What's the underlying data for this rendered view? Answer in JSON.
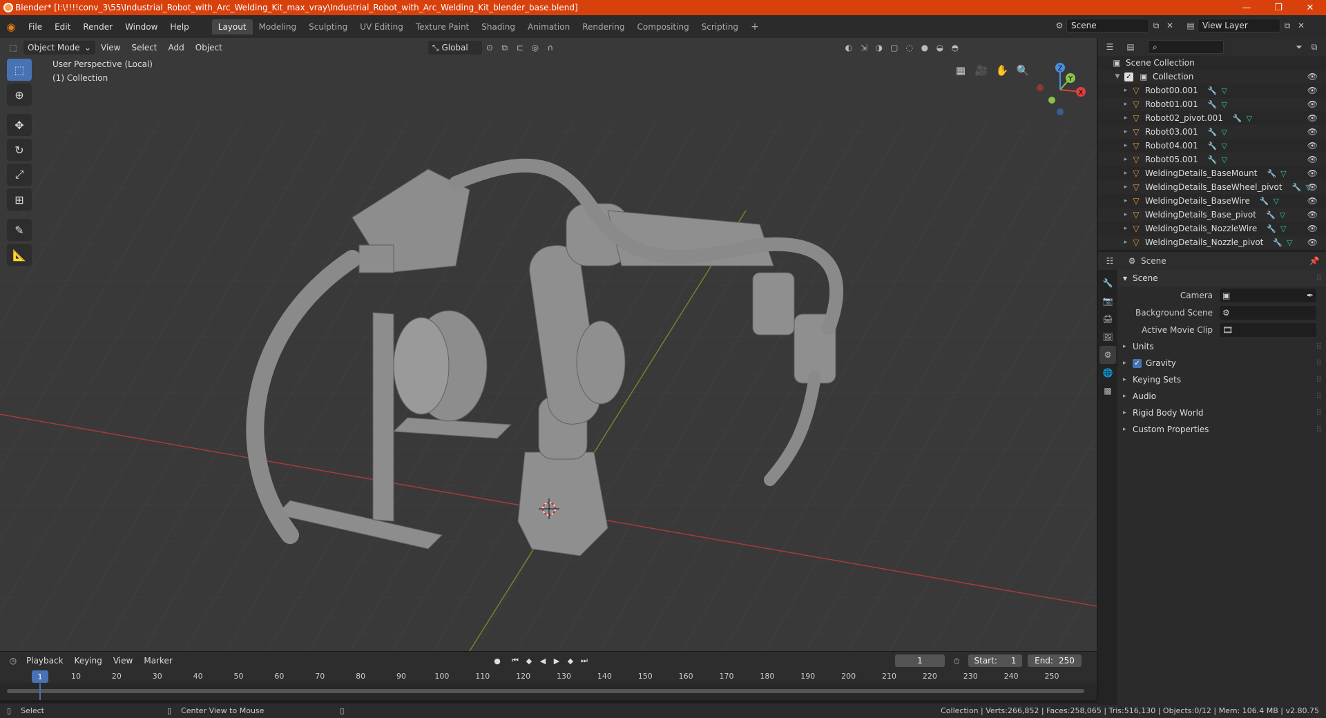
{
  "window": {
    "title": "Blender* [I:\\!!!!conv_3\\55\\Industrial_Robot_with_Arc_Welding_Kit_max_vray\\Industrial_Robot_with_Arc_Welding_Kit_blender_base.blend]",
    "minimize": "—",
    "maximize": "❐",
    "close": "✕"
  },
  "menu": [
    "File",
    "Edit",
    "Render",
    "Window",
    "Help"
  ],
  "workspaces": [
    "Layout",
    "Modeling",
    "Sculpting",
    "UV Editing",
    "Texture Paint",
    "Shading",
    "Animation",
    "Rendering",
    "Compositing",
    "Scripting"
  ],
  "active_workspace": "Layout",
  "workspace_add": "+",
  "scene_name": "Scene",
  "view_layer": "View Layer",
  "viewport": {
    "mode": "Object Mode",
    "menu": [
      "View",
      "Select",
      "Add",
      "Object"
    ],
    "transform_orientation": "Global",
    "perspective_label": "User Perspective (Local)",
    "collection_label": "(1) Collection",
    "gizmo": {
      "x": "X",
      "y": "Y",
      "z": "Z"
    }
  },
  "timeline": {
    "menu": [
      "Playback",
      "Keying",
      "View",
      "Marker"
    ],
    "current_frame": "1",
    "start_label": "Start:",
    "start": "1",
    "end_label": "End:",
    "end": "250",
    "ticks": [
      "1",
      "10",
      "20",
      "30",
      "40",
      "50",
      "60",
      "70",
      "80",
      "90",
      "100",
      "110",
      "120",
      "130",
      "140",
      "150",
      "160",
      "170",
      "180",
      "190",
      "200",
      "210",
      "220",
      "230",
      "240",
      "250"
    ]
  },
  "status": {
    "left1": "Select",
    "left2": "Center View to Mouse",
    "right": "Collection | Verts:266,852 | Faces:258,065 | Tris:516,130 | Objects:0/12 | Mem: 106.4 MB | v2.80.75"
  },
  "outliner": {
    "root": "Scene Collection",
    "collection": "Collection",
    "items": [
      "Robot00.001",
      "Robot01.001",
      "Robot02_pivot.001",
      "Robot03.001",
      "Robot04.001",
      "Robot05.001",
      "WeldingDetails_BaseMount",
      "WeldingDetails_BaseWheel_pivot",
      "WeldingDetails_BaseWire",
      "WeldingDetails_Base_pivot",
      "WeldingDetails_NozzleWire",
      "WeldingDetails_Nozzle_pivot"
    ]
  },
  "properties": {
    "context": "Scene",
    "panel": "Scene",
    "camera_label": "Camera",
    "background_label": "Background Scene",
    "movieclip_label": "Active Movie Clip",
    "sections": [
      "Units",
      "Gravity",
      "Keying Sets",
      "Audio",
      "Rigid Body World",
      "Custom Properties"
    ]
  },
  "colors": {
    "accent": "#4772b3",
    "titlebar": "#d8400c",
    "object_icon": "#ec9a3c"
  }
}
